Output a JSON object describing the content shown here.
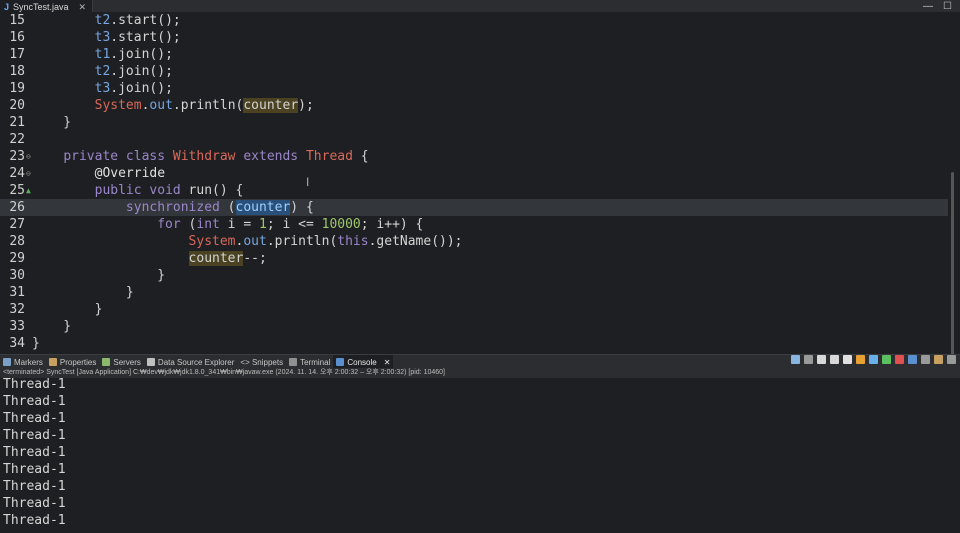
{
  "editor_tab": {
    "icon": "J",
    "title": "SyncTest.java",
    "close": "✕"
  },
  "window_controls": {
    "minimize": "—",
    "maximize": "☐"
  },
  "code_lines": [
    {
      "no": "15",
      "marker": ""
    },
    {
      "no": "16",
      "marker": ""
    },
    {
      "no": "17",
      "marker": ""
    },
    {
      "no": "18",
      "marker": ""
    },
    {
      "no": "19",
      "marker": ""
    },
    {
      "no": "20",
      "marker": ""
    },
    {
      "no": "21",
      "marker": ""
    },
    {
      "no": "22",
      "marker": ""
    },
    {
      "no": "23",
      "marker": "⊖"
    },
    {
      "no": "24",
      "marker": "⊖"
    },
    {
      "no": "25",
      "marker": "▲"
    },
    {
      "no": "26",
      "marker": ""
    },
    {
      "no": "27",
      "marker": ""
    },
    {
      "no": "28",
      "marker": ""
    },
    {
      "no": "29",
      "marker": ""
    },
    {
      "no": "30",
      "marker": ""
    },
    {
      "no": "31",
      "marker": ""
    },
    {
      "no": "32",
      "marker": ""
    },
    {
      "no": "33",
      "marker": ""
    },
    {
      "no": "34",
      "marker": ""
    }
  ],
  "code": {
    "l15": [
      "        ",
      "t2",
      ".start();"
    ],
    "l16": [
      "        ",
      "t3",
      ".start();"
    ],
    "l17": [
      "        ",
      "t1",
      ".join();"
    ],
    "l18": [
      "        ",
      "t2",
      ".join();"
    ],
    "l19": [
      "        ",
      "t3",
      ".join();"
    ],
    "l20": [
      "        ",
      "System",
      ".",
      "out",
      ".println(",
      "counter",
      ");"
    ],
    "l21": [
      "    }"
    ],
    "l23": [
      "    ",
      "private class",
      " ",
      "Withdraw",
      " ",
      "extends",
      " ",
      "Thread",
      " {"
    ],
    "l24": [
      "        ",
      "@Override"
    ],
    "l25": [
      "        ",
      "public void",
      " run() {"
    ],
    "l26": [
      "            ",
      "synchronized",
      " (",
      "counter",
      ") {"
    ],
    "l27": [
      "                ",
      "for",
      " (",
      "int",
      " i = ",
      "1",
      "; i <= ",
      "10000",
      "; i++) {"
    ],
    "l28": [
      "                    ",
      "System",
      ".",
      "out",
      ".println(",
      "this",
      ".getName());"
    ],
    "l29": [
      "                    ",
      "counter",
      "--;"
    ],
    "l30": [
      "                }"
    ],
    "l31": [
      "            }"
    ],
    "l32": [
      "        }"
    ],
    "l33": [
      "    }"
    ],
    "l34": [
      "}"
    ]
  },
  "views": [
    {
      "label": "Markers",
      "color": "#7aa0c8"
    },
    {
      "label": "Properties",
      "color": "#c8a060"
    },
    {
      "label": "Servers",
      "color": "#8cb86a"
    },
    {
      "label": "Data Source Explorer",
      "color": "#c0c0c0"
    },
    {
      "label": "<> Snippets",
      "color": ""
    },
    {
      "label": "Terminal",
      "color": "#909090"
    },
    {
      "label": "Console",
      "color": "#5a8fd0",
      "close": "✕"
    }
  ],
  "toolbar_colors": [
    "#8ab4e0",
    "#9a9a9a",
    "#d8d8d8",
    "#d8d8d8",
    "#e0e0e0",
    "#e8a030",
    "#6ab0e8",
    "#5ac060",
    "#e05050",
    "#5a8fd0",
    "#9a9a9a",
    "#c8a060",
    "#9a9a9a"
  ],
  "console_status": "<terminated> SyncTest [Java Application] C:₩dev₩jdk₩jdk1.8.0_341₩bin₩javaw.exe  (2024. 11. 14. 오후 2:00:32 – 오후 2:00:32) [pid: 10460]",
  "console_lines": [
    "Thread-1",
    "Thread-1",
    "Thread-1",
    "Thread-1",
    "Thread-1",
    "Thread-1",
    "Thread-1",
    "Thread-1",
    "Thread-1"
  ],
  "cursor_glyph": "I"
}
